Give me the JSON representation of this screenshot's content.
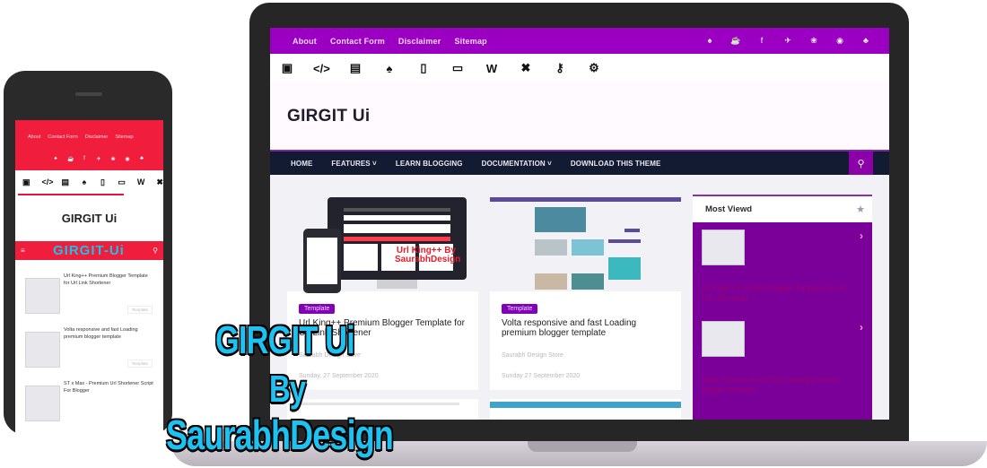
{
  "desktop": {
    "top_links": [
      "About",
      "Contact Form",
      "Disclaimer",
      "Sitemap"
    ],
    "social_icons": [
      "android-icon",
      "coffee-icon",
      "facebook-icon",
      "twitter-icon",
      "dribbble-icon",
      "eye-icon",
      "user-icon"
    ],
    "social_glyphs": [
      "♠",
      "☕",
      "f",
      "✈",
      "❀",
      "◉",
      "♣"
    ],
    "category_icons": [
      "blogger-icon",
      "code-icon",
      "folder-icon",
      "android-icon",
      "mobile-icon",
      "money-icon",
      "wordpress-icon",
      "tools-icon",
      "key-icon",
      "gears-icon"
    ],
    "category_glyphs": [
      "▣",
      "</>",
      "▤",
      "♠",
      "▯",
      "▭",
      "W",
      "✖",
      "⚷",
      "⚙"
    ],
    "site_title": "GIRGIT Ui",
    "main_nav": [
      "HOME",
      "FEATURES ˅",
      "LEARN BLOGGING",
      "DOCUMENTATION ˅",
      "DOWNLOAD THIS THEME"
    ],
    "search_glyph": "⚲",
    "posts": [
      {
        "label": "Template",
        "title": "Url King++ Premium Blogger Template for Url Link Shortener",
        "author": "Saurabh Design Store",
        "date": "Sunday, 27 September 2020",
        "thumb_overlay": "Url King++ By SaurabhDesign"
      },
      {
        "label": "Template",
        "title": "Volta responsive and fast Loading premium blogger template",
        "author": "Saurabh Design Store",
        "date": "Sunday 27 September 2020"
      }
    ],
    "sidebar": {
      "title": "Most Viewd",
      "star_glyph": "★",
      "chevron_glyph": "›",
      "items": [
        {
          "title": "Url King++ Premium Blogger Template for Url Link Shortener"
        },
        {
          "title": "Volta responsive and fast Loading premium blogger template"
        }
      ]
    }
  },
  "mobile": {
    "top_links": [
      "About",
      "Contact Form",
      "Disclaimer",
      "Sitemap"
    ],
    "social_glyphs": [
      "♠",
      "☕",
      "f",
      "✈",
      "❀",
      "◉",
      "♣"
    ],
    "category_glyphs": [
      "▣",
      "</>",
      "▤",
      "♠",
      "▯",
      "▭",
      "W",
      "✖"
    ],
    "site_title": "GIRGIT Ui",
    "nav_logo": "GIRGIT-Ui",
    "menu_glyph": "≡",
    "search_glyph": "⚲",
    "posts": [
      {
        "title": "Url King++ Premium Blogger Template for Url Link Shortener",
        "tag": "Template"
      },
      {
        "title": "Volta responsive and fast Loading premium blogger template",
        "tag": "Template"
      },
      {
        "title": "ST x Max - Premium Url Shortener Script For Blogger"
      }
    ]
  },
  "overlay": {
    "line1": "GIRGIT Ui",
    "line2": "By",
    "line3": "SaurabhDesign"
  }
}
